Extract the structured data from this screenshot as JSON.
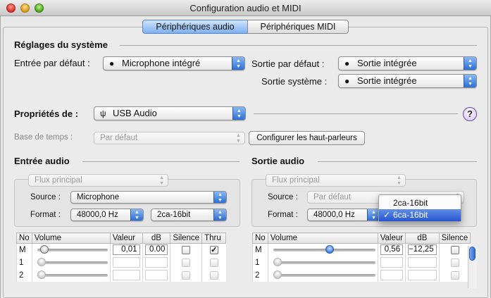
{
  "window": {
    "title": "Configuration audio et MIDI"
  },
  "tabs": [
    {
      "label": "Périphériques audio",
      "selected": true
    },
    {
      "label": "Périphériques MIDI",
      "selected": false
    }
  ],
  "system": {
    "heading": "Réglages du système",
    "input_label": "Entrée par défaut :",
    "input_value": "Microphone intégré",
    "output_label": "Sortie par défaut :",
    "output_value": "Sortie intégrée",
    "system_output_label": "Sortie système :",
    "system_output_value": "Sortie intégrée"
  },
  "properties": {
    "label": "Propriétés de :",
    "device": "USB Audio",
    "help": "?",
    "timebase_label": "Base de temps :",
    "timebase_value": "Par défaut",
    "configure_speakers": "Configurer les haut-parleurs"
  },
  "audio_input": {
    "heading": "Entrée audio",
    "stream": "Flux principal",
    "source_label": "Source :",
    "source_value": "Microphone",
    "format_label": "Format :",
    "rate": "48000,0 Hz",
    "bits": "2ca-16bit",
    "columns": [
      "No",
      "Volume",
      "Valeur",
      "dB",
      "Silence",
      "Thru"
    ],
    "rows": [
      {
        "no": "M",
        "volume": 0.05,
        "value": "0,01",
        "db": "0.00",
        "mute": false,
        "thru": true,
        "enabled": true
      },
      {
        "no": "1",
        "volume": 0.0,
        "value": "",
        "db": "",
        "mute": false,
        "thru": false,
        "enabled": false
      },
      {
        "no": "2",
        "volume": 0.0,
        "value": "",
        "db": "",
        "mute": false,
        "thru": false,
        "enabled": false
      }
    ]
  },
  "audio_output": {
    "heading": "Sortie audio",
    "stream": "Flux principal",
    "source_label": "Source :",
    "source_value": "Par défaut",
    "format_label": "Format :",
    "rate": "48000,0 Hz",
    "columns": [
      "No",
      "Volume",
      "Valeur",
      "dB",
      "Silence"
    ],
    "rows": [
      {
        "no": "M",
        "volume": 0.56,
        "value": "0,56",
        "db": "−12,25",
        "mute": false,
        "enabled": true
      },
      {
        "no": "1",
        "volume": 0.0,
        "value": "",
        "db": "",
        "mute": false,
        "enabled": false
      },
      {
        "no": "2",
        "volume": 0.0,
        "value": "",
        "db": "",
        "mute": false,
        "enabled": false
      }
    ],
    "format_menu": {
      "items": [
        "2ca-16bit",
        "6ca-16bit"
      ],
      "selected": "6ca-16bit",
      "check": "✓"
    }
  },
  "colors": {
    "accent": "#2f6dd4",
    "tab_selected": "#7eb0ef"
  }
}
